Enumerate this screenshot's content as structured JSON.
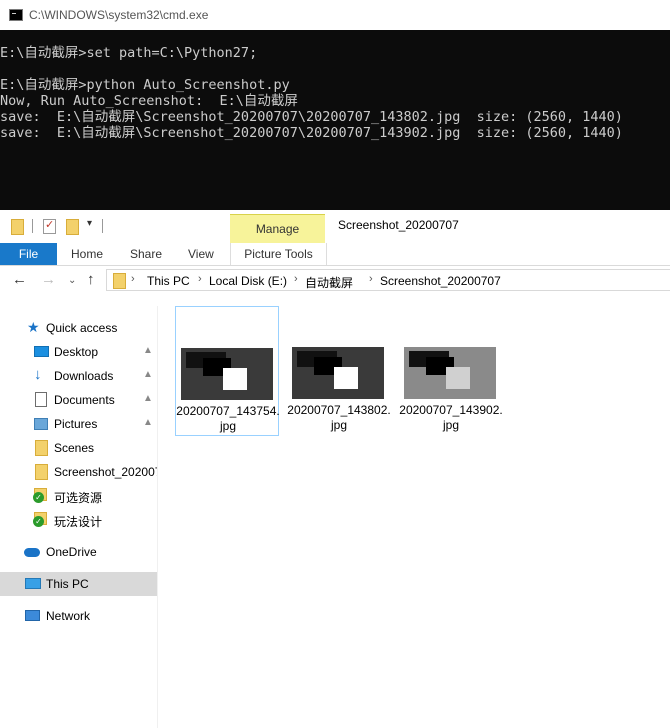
{
  "cmd": {
    "title": "C:\\WINDOWS\\system32\\cmd.exe",
    "lines": [
      "E:\\自动截屏>set path=C:\\Python27;",
      "",
      "E:\\自动截屏>python Auto_Screenshot.py",
      "Now, Run Auto_Screenshot:  E:\\自动截屏",
      "save:  E:\\自动截屏\\Screenshot_20200707\\20200707_143802.jpg  size: (2560, 1440)",
      "save:  E:\\自动截屏\\Screenshot_20200707\\20200707_143902.jpg  size: (2560, 1440)"
    ]
  },
  "explorer": {
    "contextual_tab_label": "Manage",
    "window_title": "Screenshot_20200707",
    "tabs": {
      "file": "File",
      "home": "Home",
      "share": "Share",
      "view": "View",
      "picture_tools": "Picture Tools"
    },
    "breadcrumb": [
      "This PC",
      "Local Disk (E:)",
      "自动截屏",
      "Screenshot_20200707"
    ],
    "nav": {
      "quick_access": "Quick access",
      "desktop": "Desktop",
      "downloads": "Downloads",
      "documents": "Documents",
      "pictures": "Pictures",
      "scenes": "Scenes",
      "screenshot_folder": "Screenshot_20200707",
      "optional_resources": "可选资源",
      "gameplay_design": "玩法设计",
      "onedrive": "OneDrive",
      "this_pc": "This PC",
      "network": "Network"
    },
    "files": [
      {
        "name_line1": "20200707_143754.",
        "name_line2": "jpg",
        "selected": true
      },
      {
        "name_line1": "20200707_143802.",
        "name_line2": "jpg",
        "selected": false
      },
      {
        "name_line1": "20200707_143902.",
        "name_line2": "jpg",
        "selected": false
      }
    ]
  },
  "colors": {
    "file_tab": "#1979ca",
    "manage_tab": "#f7f39a",
    "console_bg": "#0c0c0c",
    "selection": "#99d1ff"
  }
}
